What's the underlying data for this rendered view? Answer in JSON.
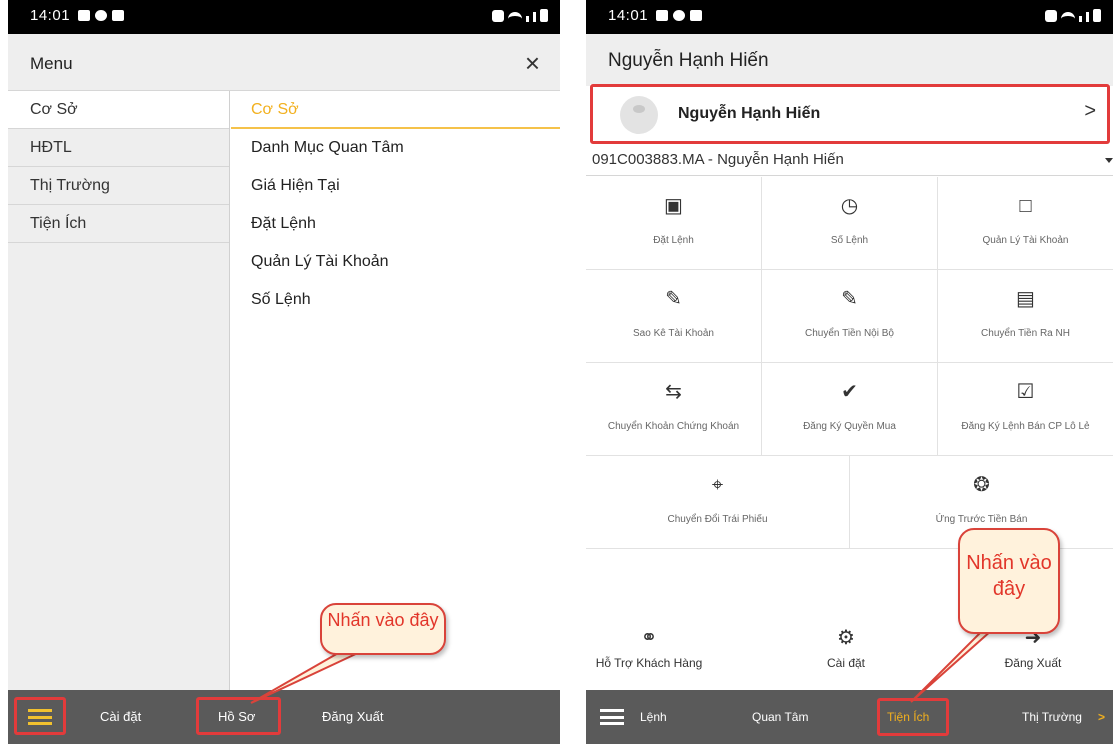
{
  "left": {
    "status": {
      "time": "14:01"
    },
    "menu_title": "Menu",
    "close_glyph": "×",
    "categories": [
      "Cơ Sở",
      "HĐTL",
      "Thị Trường",
      "Tiện Ích"
    ],
    "items": [
      "Cơ Sở",
      "Danh Mục Quan Tâm",
      "Giá Hiện Tại",
      "Đặt Lệnh",
      "Quản Lý Tài Khoản",
      "Số Lệnh"
    ],
    "bottom": [
      "Cài đặt",
      "Hồ Sơ",
      "Đăng Xuất"
    ],
    "callout": "Nhấn vào đây"
  },
  "right": {
    "status": {
      "time": "14:01"
    },
    "header_title": "Nguyễn Hạnh Hiến",
    "profile_name": "Nguyễn Hạnh Hiến",
    "account": "091C003883.MA - Nguyễn Hạnh Hiến",
    "grid": [
      [
        {
          "icon": "clipboard-check-icon",
          "label": "Đặt Lệnh"
        },
        {
          "icon": "clock-icon",
          "label": "Số Lệnh"
        },
        {
          "icon": "clipboard-icon",
          "label": "Quản Lý Tài Khoản"
        }
      ],
      [
        {
          "icon": "edit-icon",
          "label": "Sao Kê Tài Khoản"
        },
        {
          "icon": "edit-icon",
          "label": "Chuyển Tiền Nội Bộ"
        },
        {
          "icon": "wallet-icon",
          "label": "Chuyển Tiền Ra NH"
        }
      ],
      [
        {
          "icon": "swap-icon",
          "label": "Chuyển Khoản Chứng Khoán"
        },
        {
          "icon": "shield-check-icon",
          "label": "Đăng Ký Quyền Mua"
        },
        {
          "icon": "calendar-check-icon",
          "label": "Đăng Ký Lệnh Bán CP Lô Lẻ"
        }
      ],
      [
        {
          "icon": "crop-icon",
          "label": "Chuyển Đổi Trái Phiếu"
        },
        {
          "icon": "lifebuoy-icon",
          "label": "Ứng Trước Tiền Bán"
        }
      ]
    ],
    "bottom_items": [
      {
        "icon": "headset-icon",
        "label": "Hỗ Trợ Khách Hàng"
      },
      {
        "icon": "gear-icon",
        "label": "Cài đặt"
      },
      {
        "icon": "logout-icon",
        "label": "Đăng Xuất"
      }
    ],
    "tabs": [
      "Lệnh",
      "Quan Tâm",
      "Tiện Ích",
      "Thị Trường"
    ],
    "callout": "Nhấn vào đây"
  },
  "colors": {
    "accent": "#f2b01e",
    "highlight_box": "#e23b3b",
    "tabbar": "#5a5a5a"
  }
}
